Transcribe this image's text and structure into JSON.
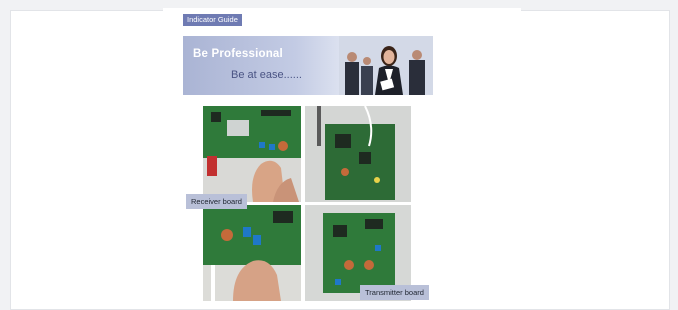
{
  "header": {
    "tag_label": "Indicator Guide"
  },
  "banner": {
    "title": "Be Professional",
    "subtitle": "Be at ease......"
  },
  "captions": {
    "receiver": "Receiver board",
    "transmitter": "Transmitter board"
  },
  "colors": {
    "tag_bg": "#6f7bb3",
    "caption_bg": "#b9c0d8",
    "board_green": "#2f7a3a"
  }
}
